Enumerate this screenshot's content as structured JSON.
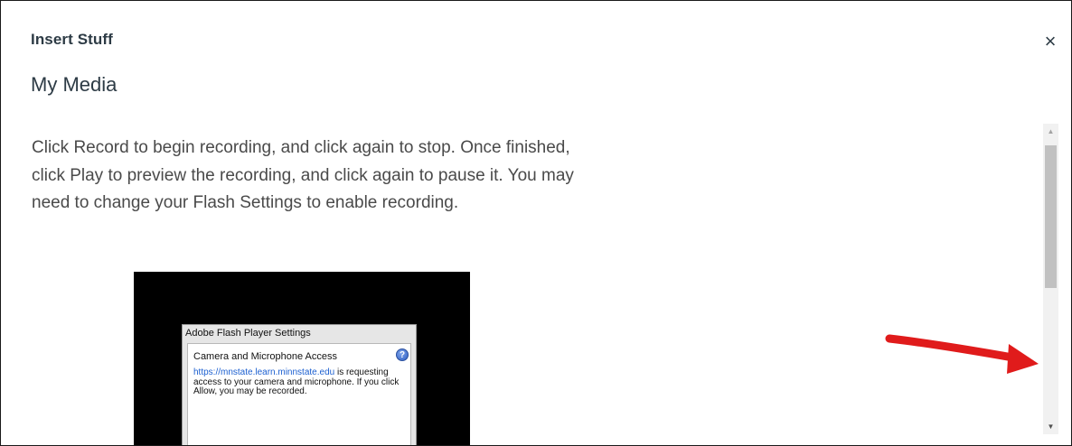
{
  "dialog": {
    "title": "Insert Stuff",
    "close_glyph": "×",
    "section_heading": "My Media"
  },
  "content": {
    "instructions": "Click Record to begin recording, and click again to stop. Once finished, click Play to preview the recording, and click again to pause it. You may need to change your Flash Settings to enable recording."
  },
  "flash_settings": {
    "title": "Adobe Flash Player Settings",
    "heading": "Camera and Microphone Access",
    "help_glyph": "?",
    "link": "https://mnstate.learn.minnstate.edu",
    "message": " is requesting access to your camera and microphone. If you click Allow, you may be recorded."
  },
  "scrollbar": {
    "up_glyph": "▲",
    "down_glyph": "▼"
  },
  "colors": {
    "annotation_arrow": "#e01b1b"
  }
}
